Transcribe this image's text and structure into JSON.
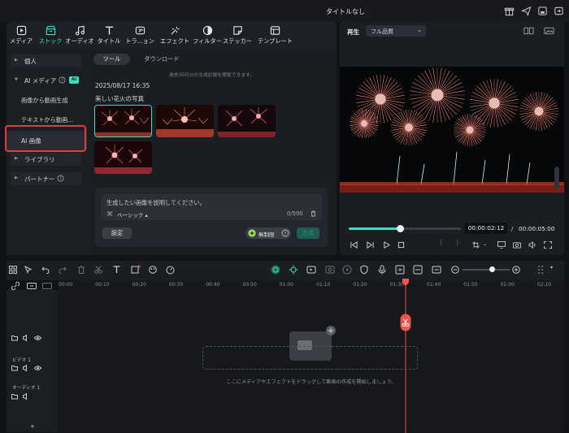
{
  "window": {
    "title": "タイトルなし"
  },
  "media_tabs": [
    {
      "label": "メディア",
      "icon": "media-icon"
    },
    {
      "label": "ストック",
      "icon": "stock-icon",
      "active": true
    },
    {
      "label": "オーディオ",
      "icon": "music-note-icon"
    },
    {
      "label": "タイトル",
      "icon": "title-t-icon"
    },
    {
      "label": "トラ...ョン",
      "icon": "transition-icon"
    },
    {
      "label": "エフェクト",
      "icon": "effect-icon"
    },
    {
      "label": "フィルター",
      "icon": "filter-icon"
    },
    {
      "label": "ステッカー",
      "icon": "sticker-icon"
    },
    {
      "label": "テンプレート",
      "icon": "template-icon"
    }
  ],
  "sidebar": {
    "items": [
      "個人",
      "AI メディア",
      "ライブラリ",
      "パートナー"
    ],
    "ai_badge": "AI",
    "subitems": [
      "画像から動画生成",
      "テキストから動画...",
      "AI 画像"
    ]
  },
  "content": {
    "tabs": [
      "ツール",
      "ダウンロード"
    ],
    "notice": "過去30日分の生成記録を閲覧できます。",
    "timestamp": "2025/08/17 16:35",
    "caption": "美しい花火の写真"
  },
  "prompt": {
    "placeholder": "生成したい画像を説明してください。",
    "style": "ベーシック",
    "counter": "0/500",
    "settings": "設定",
    "unlimited": "無制限",
    "generate": "生成"
  },
  "preview": {
    "play_label": "再生",
    "quality": "フル品質",
    "current_time": "00:00:02:12",
    "total_time": "00:00:05:00",
    "separator": "/",
    "progress": 0.46
  },
  "timeline": {
    "ticks": [
      "00:00",
      "00:10",
      "00:20",
      "00:30",
      "00:40",
      "00:50",
      "01:00",
      "01:10",
      "01:20",
      "01:30",
      "01:40",
      "01:50",
      "02:00",
      "02:10"
    ],
    "video_track": "ビデオ 1",
    "audio_track": "オーディオ 1",
    "drop_hint": "ここにメディアやエフェクトをドラッグして動画の作成を開始しましょう。"
  },
  "colors": {
    "accent": "#38e0c2",
    "highlight": "#e23d3d",
    "playhead": "#f0524f"
  }
}
